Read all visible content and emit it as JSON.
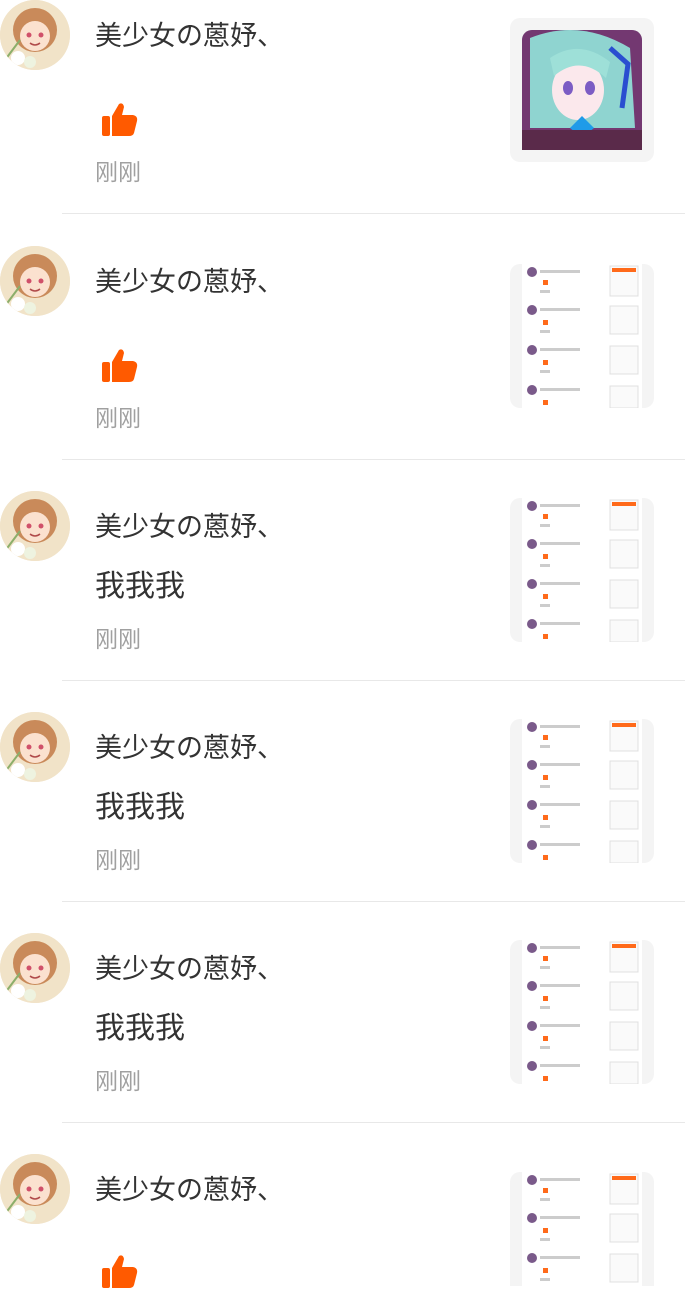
{
  "colors": {
    "like": "#ff5a00",
    "text": "#333333",
    "muted": "#a0a0a0",
    "divider": "#e8e8e8"
  },
  "icons": {
    "like": "thumbs-up-icon"
  },
  "notifications": [
    {
      "user_name": "美少女の蒽妤、",
      "content_type": "like",
      "text": "",
      "time": "刚刚",
      "thumbnail": "anime-image"
    },
    {
      "user_name": "美少女の蒽妤、",
      "content_type": "like",
      "text": "",
      "time": "刚刚",
      "thumbnail": "screenshot"
    },
    {
      "user_name": "美少女の蒽妤、",
      "content_type": "comment",
      "text": "我我我",
      "time": "刚刚",
      "thumbnail": "screenshot"
    },
    {
      "user_name": "美少女の蒽妤、",
      "content_type": "comment",
      "text": "我我我",
      "time": "刚刚",
      "thumbnail": "screenshot"
    },
    {
      "user_name": "美少女の蒽妤、",
      "content_type": "comment",
      "text": "我我我",
      "time": "刚刚",
      "thumbnail": "screenshot"
    },
    {
      "user_name": "美少女の蒽妤、",
      "content_type": "like",
      "text": "",
      "time": "",
      "thumbnail": "screenshot"
    }
  ]
}
